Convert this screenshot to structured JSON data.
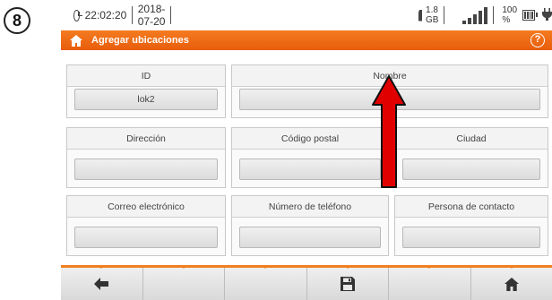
{
  "step_number": "8",
  "status": {
    "time": "22:02:20",
    "date": "2018-07-20",
    "storage": "1.8 GB",
    "battery": "100 %"
  },
  "title": "Agregar ubicaciones",
  "form": {
    "id": {
      "label": "ID",
      "value": "lok2"
    },
    "name": {
      "label": "Nombre",
      "value": ""
    },
    "address": {
      "label": "Dirección",
      "value": ""
    },
    "postal_code": {
      "label": "Código postal",
      "value": ""
    },
    "city": {
      "label": "Ciudad",
      "value": ""
    },
    "email": {
      "label": "Correo electrónico",
      "value": ""
    },
    "phone": {
      "label": "Número de teléfono",
      "value": ""
    },
    "contact": {
      "label": "Persona de contacto",
      "value": ""
    }
  },
  "toolbar": {
    "icons": [
      "back-arrow-icon",
      "",
      "",
      "save-icon",
      "",
      "home-icon"
    ]
  },
  "colors": {
    "accent": "#f47b20",
    "annotation_arrow": "#e00000"
  }
}
